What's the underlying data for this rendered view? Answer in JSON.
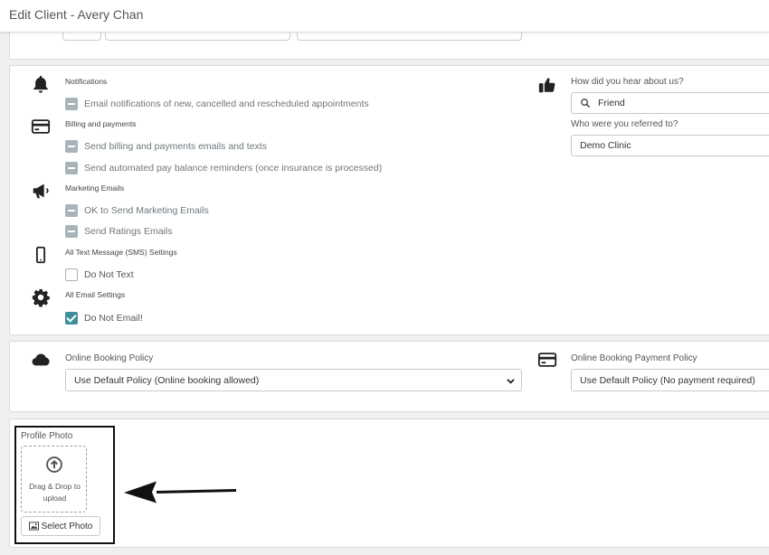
{
  "header": {
    "title": "Edit Client - Avery Chan"
  },
  "communication": {
    "notifications_heading": "Notifications",
    "email_notifications_label": "Email notifications of new, cancelled and rescheduled appointments",
    "billing_heading": "Billing and payments",
    "billing_emails_label": "Send billing and payments emails and texts",
    "pay_balance_label": "Send automated pay balance reminders (once insurance is processed)",
    "marketing_heading": "Marketing Emails",
    "marketing_ok_label": "OK to Send Marketing Emails",
    "ratings_label": "Send Ratings Emails",
    "sms_heading": "All Text Message (SMS) Settings",
    "do_not_text_label": "Do Not Text",
    "email_settings_heading": "All Email Settings",
    "do_not_email_label": "Do Not Email!"
  },
  "referral": {
    "hear_label": "How did you hear about us?",
    "hear_value": "Friend",
    "referred_label": "Who were you referred to?",
    "referred_value": "Demo Clinic"
  },
  "booking": {
    "policy_label": "Online Booking Policy",
    "policy_value": "Use Default Policy (Online booking allowed)",
    "payment_policy_label": "Online Booking Payment Policy",
    "payment_policy_value": "Use Default Policy (No payment required)"
  },
  "profile_photo": {
    "label": "Profile Photo",
    "drop_text": "Drag & Drop to upload",
    "select_button": "Select Photo"
  },
  "colors": {
    "checkbox_checked": "#3f8f9b",
    "checkbox_indeterminate": "#a9b4ba",
    "header_bg": "#ffffff",
    "page_bg": "#eef0f2"
  },
  "icons": [
    "bell-icon",
    "credit-card-icon",
    "megaphone-icon",
    "mobile-phone-icon",
    "gear-icon",
    "thumbs-up-icon",
    "search-icon",
    "cloud-icon",
    "chevron-down-icon",
    "upload-icon",
    "image-icon",
    "arrow-icon"
  ]
}
